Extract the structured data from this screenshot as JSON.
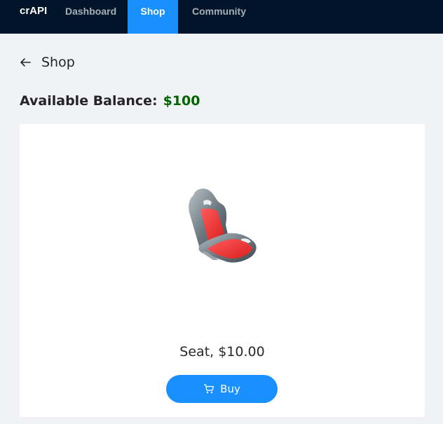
{
  "header": {
    "logo": "crAPI",
    "nav": [
      {
        "label": "Dashboard",
        "active": false
      },
      {
        "label": "Shop",
        "active": true
      },
      {
        "label": "Community",
        "active": false
      }
    ],
    "background": "#001529",
    "active_color": "#1890ff"
  },
  "page": {
    "title": "Shop",
    "back_icon": "arrow-left-icon"
  },
  "balance": {
    "label": "Available Balance:",
    "value": "$100",
    "value_color": "#006400"
  },
  "products": [
    {
      "image_icon": "car-seat-image",
      "title": "Seat, $10.00",
      "buy_label": "Buy",
      "buy_icon": "shopping-cart-icon"
    }
  ]
}
